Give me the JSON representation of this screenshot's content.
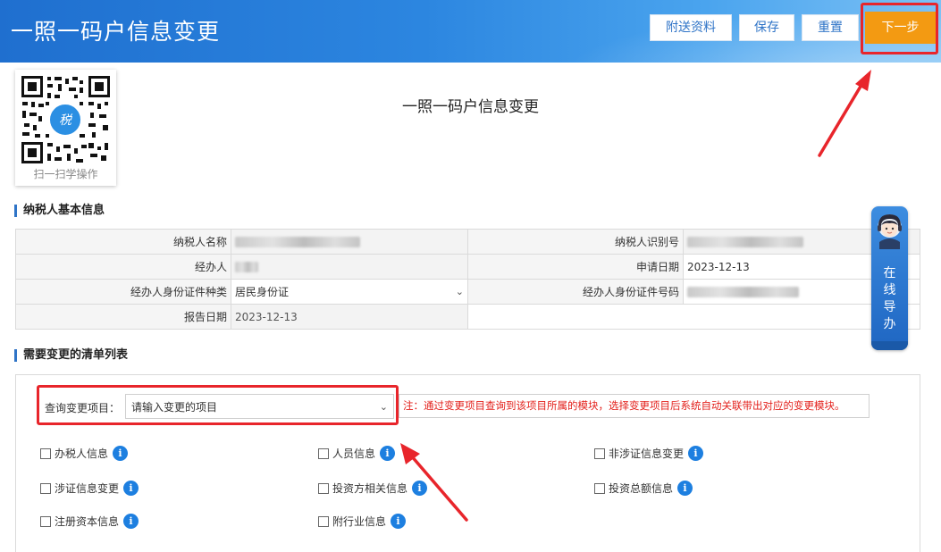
{
  "header": {
    "title": "一照一码户信息变更",
    "buttons": {
      "attach": "附送资料",
      "save": "保存",
      "reset": "重置",
      "next": "下一步"
    }
  },
  "qr": {
    "caption": "扫一扫学操作"
  },
  "page_title": "一照一码户信息变更",
  "basic_info": {
    "section_title": "纳税人基本信息",
    "taxpayer_name_label": "纳税人名称",
    "taxpayer_id_label": "纳税人识别号",
    "agent_label": "经办人",
    "apply_date_label": "申请日期",
    "apply_date_value": "2023-12-13",
    "agent_id_type_label": "经办人身份证件种类",
    "agent_id_type_value": "居民身份证",
    "agent_id_no_label": "经办人身份证件号码",
    "report_date_label": "报告日期",
    "report_date_value": "2023-12-13"
  },
  "change_list": {
    "section_title": "需要变更的清单列表",
    "query_label": "查询变更项目：",
    "query_placeholder": "请输入变更的项目",
    "note": "注：通过变更项目查询到该项目所属的模块，选择变更项目后系统自动关联带出对应的变更模块。",
    "items": [
      "办税人信息",
      "人员信息",
      "非涉证信息变更",
      "涉证信息变更",
      "投资方相关信息",
      "投资总额信息",
      "注册资本信息",
      "附行业信息"
    ]
  },
  "guide": {
    "text": "在线导办"
  },
  "colors": {
    "header_blue": "#2c86e0",
    "next_orange": "#f39a12",
    "highlight_red": "#e8252b",
    "info_blue": "#1d7fe0"
  }
}
